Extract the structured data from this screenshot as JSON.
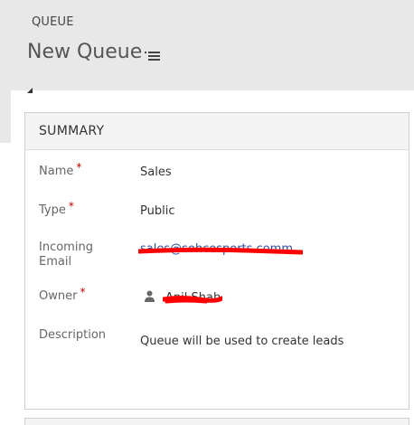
{
  "header": {
    "entity_type": "QUEUE",
    "record_title": "New Queue"
  },
  "summary": {
    "title": "SUMMARY",
    "fields": {
      "name": {
        "label": "Name",
        "required_marker": "*",
        "value": "Sales"
      },
      "type": {
        "label": "Type",
        "required_marker": "*",
        "value": "Public"
      },
      "incoming_email": {
        "label_line1": "Incoming",
        "label_line2": "Email",
        "value": "sales@sohcesports.comm..."
      },
      "owner": {
        "label": "Owner",
        "required_marker": "*",
        "value": "Anil Shah"
      },
      "description": {
        "label": "Description",
        "value": "Queue will be used to create leads"
      }
    }
  },
  "icons": {
    "title_menu": "list-menu-icon",
    "owner": "user-icon"
  },
  "colors": {
    "header_bg": "#e8e8e8",
    "required": "#c00000",
    "link": "#2d4f9e",
    "redaction": "#ff0000"
  }
}
